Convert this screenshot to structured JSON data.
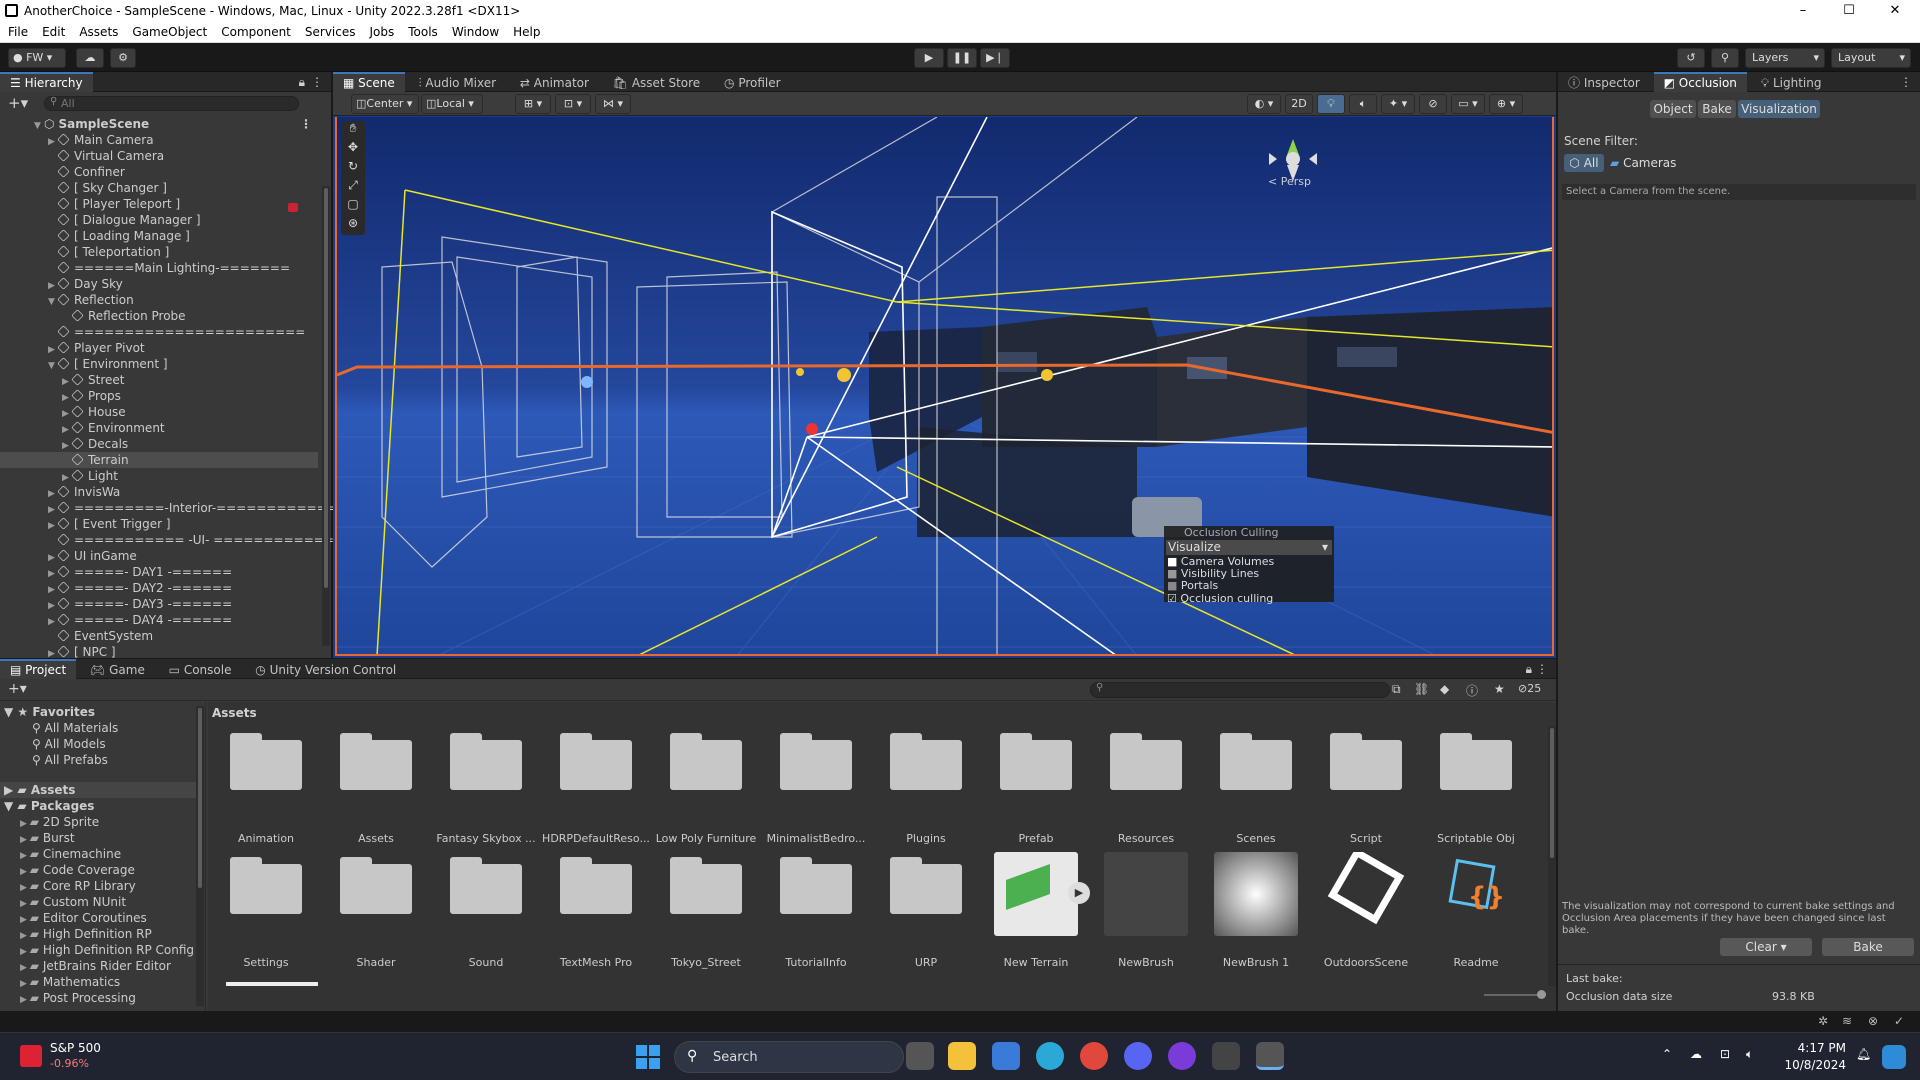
{
  "window": {
    "title": "AnotherChoice - SampleScene - Windows, Mac, Linux - Unity 2022.3.28f1 <DX11>",
    "min": "–",
    "max": "☐",
    "close": "✕"
  },
  "menu": [
    "File",
    "Edit",
    "Assets",
    "GameObject",
    "Component",
    "Services",
    "Jobs",
    "Tools",
    "Window",
    "Help"
  ],
  "toolbar": {
    "account": "FW ▾",
    "layers": "Layers",
    "layout": "Layout"
  },
  "hierarchy": {
    "title": "Hierarchy",
    "search_placeholder": "All",
    "scene": "SampleScene",
    "items": [
      {
        "label": "Main Camera",
        "depth": 1,
        "arrow": true
      },
      {
        "label": "Virtual Camera",
        "depth": 1,
        "arrow": false
      },
      {
        "label": "Confiner",
        "depth": 1,
        "arrow": false
      },
      {
        "label": "[ Sky Changer ]",
        "depth": 1,
        "arrow": false
      },
      {
        "label": "[ Player Teleport ]",
        "depth": 1,
        "arrow": false
      },
      {
        "label": "[ Dialogue Manager ]",
        "depth": 1,
        "arrow": false
      },
      {
        "label": "[ Loading Manage ]",
        "depth": 1,
        "arrow": false
      },
      {
        "label": "[ Teleportation ]",
        "depth": 1,
        "arrow": false
      },
      {
        "label": "======Main Lighting-=======",
        "depth": 1,
        "arrow": false
      },
      {
        "label": "Day Sky",
        "depth": 1,
        "arrow": true
      },
      {
        "label": "Reflection",
        "depth": 1,
        "arrow": true,
        "open": true
      },
      {
        "label": "Reflection Probe",
        "depth": 2,
        "arrow": false
      },
      {
        "label": "=======================",
        "depth": 1,
        "arrow": false
      },
      {
        "label": "Player Pivot",
        "depth": 1,
        "arrow": true
      },
      {
        "label": "[ Environment ]",
        "depth": 1,
        "arrow": true,
        "open": true
      },
      {
        "label": "Street",
        "depth": 2,
        "arrow": true
      },
      {
        "label": "Props",
        "depth": 2,
        "arrow": true
      },
      {
        "label": "House",
        "depth": 2,
        "arrow": true
      },
      {
        "label": "Environment",
        "depth": 2,
        "arrow": true
      },
      {
        "label": "Decals",
        "depth": 2,
        "arrow": true
      },
      {
        "label": "Terrain",
        "depth": 2,
        "arrow": false,
        "selected": true
      },
      {
        "label": "Light",
        "depth": 2,
        "arrow": true
      },
      {
        "label": "InvisWa",
        "depth": 1,
        "arrow": true
      },
      {
        "label": "=========-Interior-============",
        "depth": 1,
        "arrow": true
      },
      {
        "label": "[ Event Trigger ]",
        "depth": 1,
        "arrow": true
      },
      {
        "label": "=========== -UI- ============",
        "depth": 1,
        "arrow": false
      },
      {
        "label": "UI inGame",
        "depth": 1,
        "arrow": true
      },
      {
        "label": "=====- DAY1 -======",
        "depth": 1,
        "arrow": true
      },
      {
        "label": "=====- DAY2 -======",
        "depth": 1,
        "arrow": true
      },
      {
        "label": "=====- DAY3 -======",
        "depth": 1,
        "arrow": true
      },
      {
        "label": "=====- DAY4 -======",
        "depth": 1,
        "arrow": true
      },
      {
        "label": "EventSystem",
        "depth": 1,
        "arrow": false
      },
      {
        "label": "[ NPC ]",
        "depth": 1,
        "arrow": true
      }
    ]
  },
  "scene_tabs": [
    "Scene",
    "Audio Mixer",
    "Animator",
    "Asset Store",
    "Profiler"
  ],
  "scene_toolbar": {
    "pivot": "Center",
    "space": "Local",
    "mode2d": "2D"
  },
  "gizmo": {
    "persp": "< Persp"
  },
  "occlusion_overlay": {
    "title": "Occlusion Culling",
    "mode": "Visualize",
    "items": [
      "Camera Volumes",
      "Visibility Lines",
      "Portals"
    ],
    "checkbox": "Occlusion culling"
  },
  "inspector": {
    "tabs": [
      "Inspector",
      "Occlusion",
      "Lighting"
    ],
    "subtabs": [
      "Object",
      "Bake",
      "Visualization"
    ],
    "scene_filter_label": "Scene Filter:",
    "filter_all": "All",
    "filter_cameras": "Cameras",
    "hint": "Select a Camera from the scene.",
    "warning": "The visualization may not correspond to current bake settings and Occlusion Area placements if they have been changed since last bake.",
    "clear": "Clear",
    "bake": "Bake",
    "last_bake": "Last bake:",
    "data_size_label": "Occlusion data size",
    "data_size": "93.8 KB"
  },
  "project": {
    "tabs": [
      "Project",
      "Game",
      "Console",
      "Unity Version Control"
    ],
    "hidden_count": "25",
    "breadcrumb": "Assets",
    "favorites": {
      "label": "Favorites",
      "items": [
        "All Materials",
        "All Models",
        "All Prefabs"
      ]
    },
    "assets_label": "Assets",
    "packages_label": "Packages",
    "packages": [
      "2D Sprite",
      "Burst",
      "Cinemachine",
      "Code Coverage",
      "Core RP Library",
      "Custom NUnit",
      "Editor Coroutines",
      "High Definition RP",
      "High Definition RP Config",
      "JetBrains Rider Editor",
      "Mathematics",
      "Post Processing"
    ],
    "row1": [
      "Animation",
      "Assets",
      "Fantasy Skybox ...",
      "HDRPDefaultReso...",
      "Low Poly Furniture",
      "MinimalistBedro...",
      "Plugins",
      "Prefab",
      "Resources",
      "Scenes",
      "Script",
      "Scriptable Obj"
    ],
    "row2_folders": [
      "Settings",
      "Shader",
      "Sound",
      "TextMesh Pro",
      "Tokyo_Street",
      "TutorialInfo",
      "URP"
    ],
    "row2_assets": [
      "New Terrain",
      "NewBrush",
      "NewBrush 1",
      "OutdoorsScene",
      "Readme"
    ]
  },
  "taskbar": {
    "stock_name": "S&P 500",
    "stock_change": "-0.96%",
    "search": "Search",
    "time": "4:17 PM",
    "date": "10/8/2024"
  },
  "colors": {
    "accent": "#3a79bb",
    "scene_bg": "#1c3a88",
    "orange_line": "#e9682c",
    "yellow": "#e6e62a"
  }
}
